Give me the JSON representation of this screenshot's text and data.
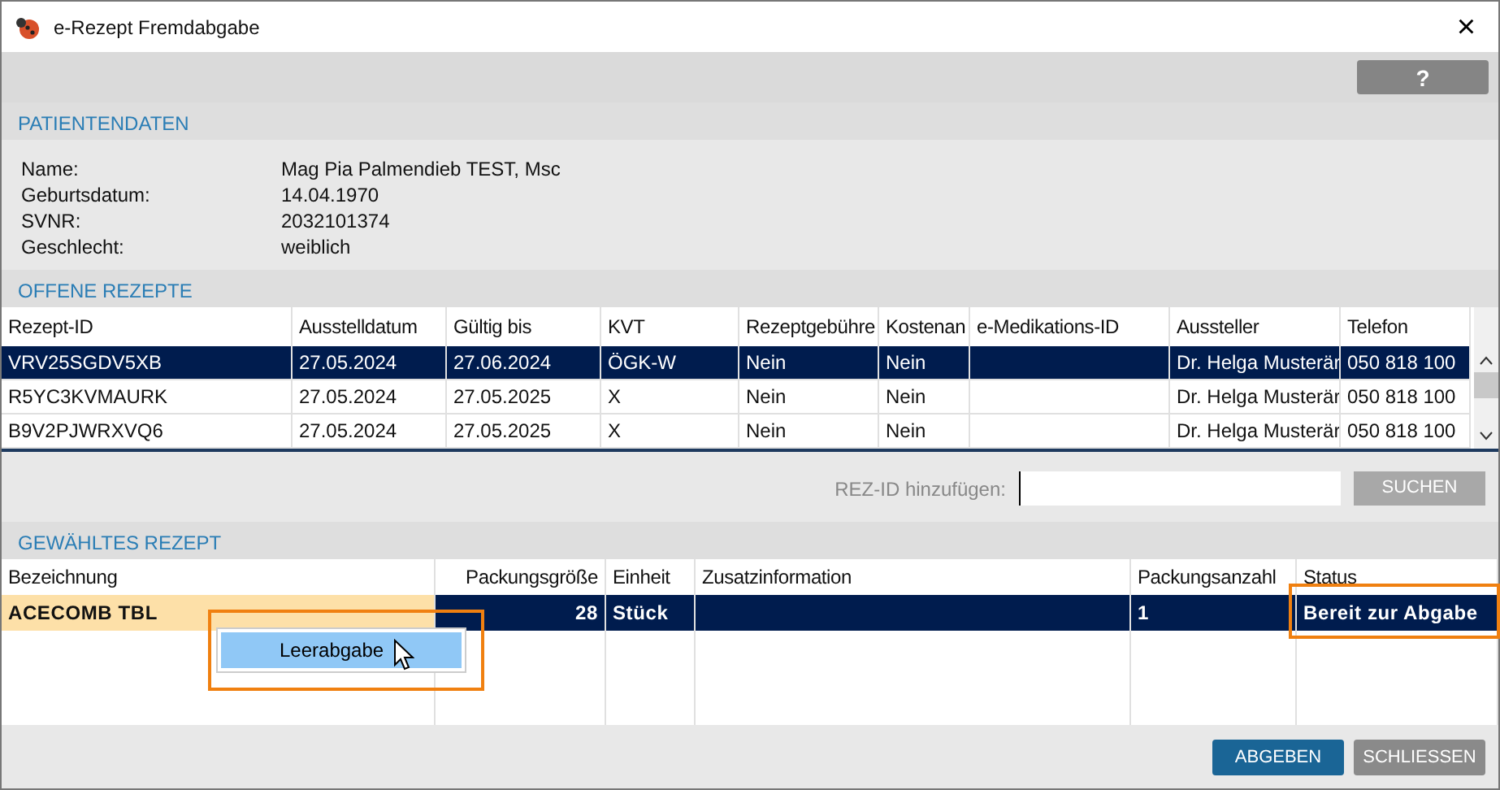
{
  "window": {
    "title": "e-Rezept Fremdabgabe",
    "close": "×"
  },
  "toolbar": {
    "help_button": "?"
  },
  "patient": {
    "title": "PATIENTENDATEN",
    "fields": [
      {
        "label": "Name:",
        "value": "Mag Pia Palmendieb TEST, Msc"
      },
      {
        "label": "Geburtsdatum:",
        "value": "14.04.1970"
      },
      {
        "label": "SVNR:",
        "value": "2032101374"
      },
      {
        "label": "Geschlecht:",
        "value": "weiblich"
      }
    ]
  },
  "open_prescriptions": {
    "title": "OFFENE REZEPTE",
    "columns": [
      "Rezept-ID",
      "Ausstelldatum",
      "Gültig bis",
      "KVT",
      "Rezeptgebühre",
      "Kostenan",
      "e-Medikations-ID",
      "Aussteller",
      "Telefon"
    ],
    "rows": [
      {
        "cells": [
          "VRV25SGDV5XB",
          "27.05.2024",
          "27.06.2024",
          "ÖGK-W",
          "Nein",
          "Nein",
          "",
          "Dr. Helga Musterär",
          "050 818 100"
        ],
        "selected": true
      },
      {
        "cells": [
          "R5YC3KVMAURK",
          "27.05.2024",
          "27.05.2025",
          "X",
          "Nein",
          "Nein",
          "",
          "Dr. Helga Musterär",
          "050 818 100"
        ],
        "selected": false
      },
      {
        "cells": [
          "B9V2PJWRXVQ6",
          "27.05.2024",
          "27.05.2025",
          "X",
          "Nein",
          "Nein",
          "",
          "Dr. Helga Musterär",
          "050 818 100"
        ],
        "selected": false
      }
    ]
  },
  "add": {
    "label": "REZ-ID hinzufügen:",
    "button": "SUCHEN",
    "button_disabled": true
  },
  "selected_prescription": {
    "title": "GEWÄHLTES REZEPT",
    "columns": [
      "Bezeichnung",
      "Packungsgröße",
      "Einheit",
      "Zusatzinformation",
      "Packungsanzahl",
      "Status"
    ],
    "rows": [
      {
        "cells": [
          "ACECOMB TBL",
          "28",
          "Stück",
          "",
          "1",
          "Bereit zur Abgabe"
        ],
        "selected": true
      }
    ]
  },
  "context_menu": {
    "items": [
      {
        "label": "Leerabgabe",
        "selected": true
      }
    ]
  },
  "footer": {
    "buttons": [
      {
        "label": "ABGEBEN",
        "kind": "primary"
      },
      {
        "label": "SCHLIESSEN",
        "kind": "secondary"
      }
    ]
  }
}
